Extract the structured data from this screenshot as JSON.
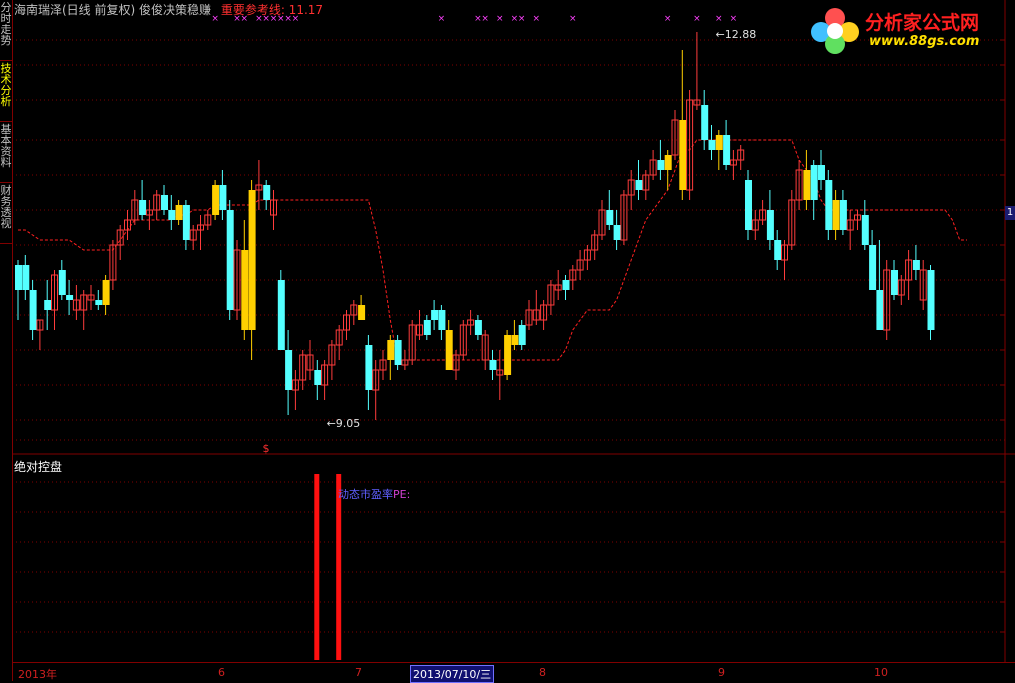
{
  "header": {
    "title": "海南瑞泽(日线 前复权) 俊俊决策稳赚",
    "ref_label": "重要参考线: 11.17"
  },
  "left_tabs": [
    {
      "label": "分时走势",
      "active": false
    },
    {
      "label": "技术分析",
      "active": true
    },
    {
      "label": "基本资料",
      "active": false
    },
    {
      "label": "财务透视",
      "active": false
    }
  ],
  "logo": {
    "brand": "分析家公式网",
    "url": "www.88gs.com"
  },
  "price_axis_tag": "1",
  "sub_panel": {
    "title": "绝对控盘",
    "label_text": "动态市盈率",
    "label_pe": "PE:"
  },
  "date_axis": {
    "labels": [
      "2013年",
      "6",
      "7",
      "8",
      "9",
      "10"
    ],
    "cursor": "2013/07/10/三"
  },
  "chart_data": {
    "type": "candlestick",
    "high_marker": "12.88",
    "low_marker": "9.05",
    "dollar_marker": "$",
    "colors": {
      "up": "#ff3c3c",
      "down": "#54ffff",
      "signal": "#ffd000",
      "ref_line": "#ff2020",
      "grid": "#800000",
      "sub_bar": "#ff1010"
    },
    "ylim": [
      8.8,
      13.0
    ],
    "candles": [
      [
        10.3,
        10.6,
        10.0,
        10.55,
        "d"
      ],
      [
        10.55,
        10.65,
        10.2,
        10.3,
        "d"
      ],
      [
        10.3,
        10.4,
        9.8,
        9.9,
        "d"
      ],
      [
        9.9,
        10.0,
        9.7,
        10.0,
        "u"
      ],
      [
        10.2,
        10.4,
        9.9,
        10.1,
        "d"
      ],
      [
        10.1,
        10.5,
        9.9,
        10.45,
        "u"
      ],
      [
        10.5,
        10.6,
        10.2,
        10.25,
        "d"
      ],
      [
        10.25,
        10.4,
        10.05,
        10.2,
        "d"
      ],
      [
        10.2,
        10.35,
        10.0,
        10.1,
        "u"
      ],
      [
        10.1,
        10.3,
        9.9,
        10.25,
        "u"
      ],
      [
        10.25,
        10.35,
        10.1,
        10.2,
        "u"
      ],
      [
        10.2,
        10.3,
        10.1,
        10.15,
        "d"
      ],
      [
        10.15,
        10.45,
        10.05,
        10.4,
        "s"
      ],
      [
        10.4,
        10.8,
        10.3,
        10.75,
        "u"
      ],
      [
        10.75,
        10.95,
        10.6,
        10.9,
        "u"
      ],
      [
        10.9,
        11.1,
        10.8,
        11.0,
        "u"
      ],
      [
        11.0,
        11.3,
        10.95,
        11.2,
        "u"
      ],
      [
        11.2,
        11.4,
        11.0,
        11.05,
        "d"
      ],
      [
        11.05,
        11.2,
        10.9,
        11.1,
        "u"
      ],
      [
        11.1,
        11.3,
        11.0,
        11.25,
        "u"
      ],
      [
        11.25,
        11.35,
        11.05,
        11.1,
        "d"
      ],
      [
        11.1,
        11.25,
        10.9,
        11.0,
        "d"
      ],
      [
        11.0,
        11.2,
        10.95,
        11.15,
        "s"
      ],
      [
        11.15,
        11.2,
        10.7,
        10.8,
        "d"
      ],
      [
        10.8,
        10.95,
        10.7,
        10.9,
        "u"
      ],
      [
        10.9,
        11.05,
        10.7,
        10.95,
        "u"
      ],
      [
        10.95,
        11.1,
        10.9,
        11.05,
        "u"
      ],
      [
        11.05,
        11.4,
        11.0,
        11.35,
        "s"
      ],
      [
        11.35,
        11.5,
        11.0,
        11.1,
        "d"
      ],
      [
        11.1,
        11.2,
        10.0,
        10.1,
        "d"
      ],
      [
        10.1,
        10.8,
        10.0,
        10.7,
        "u"
      ],
      [
        10.7,
        11.0,
        9.8,
        9.9,
        "s"
      ],
      [
        9.9,
        11.4,
        9.6,
        11.3,
        "s"
      ],
      [
        11.3,
        11.6,
        11.1,
        11.35,
        "u"
      ],
      [
        11.35,
        11.4,
        11.1,
        11.2,
        "d"
      ],
      [
        11.2,
        11.3,
        10.9,
        11.05,
        "u"
      ],
      [
        10.4,
        10.5,
        9.8,
        9.7,
        "d"
      ],
      [
        9.7,
        9.9,
        9.05,
        9.3,
        "d"
      ],
      [
        9.3,
        9.5,
        9.1,
        9.4,
        "u"
      ],
      [
        9.4,
        9.7,
        9.3,
        9.65,
        "u"
      ],
      [
        9.65,
        9.8,
        9.4,
        9.5,
        "u"
      ],
      [
        9.5,
        9.6,
        9.2,
        9.35,
        "d"
      ],
      [
        9.35,
        9.6,
        9.2,
        9.55,
        "u"
      ],
      [
        9.55,
        9.8,
        9.4,
        9.75,
        "u"
      ],
      [
        9.75,
        9.95,
        9.6,
        9.9,
        "u"
      ],
      [
        9.9,
        10.1,
        9.8,
        10.05,
        "u"
      ],
      [
        10.05,
        10.2,
        9.95,
        10.15,
        "u"
      ],
      [
        10.15,
        10.25,
        10.0,
        10.0,
        "s"
      ],
      [
        9.75,
        9.85,
        9.1,
        9.3,
        "d"
      ],
      [
        9.3,
        9.6,
        9.0,
        9.5,
        "u"
      ],
      [
        9.5,
        9.7,
        9.4,
        9.6,
        "u"
      ],
      [
        9.6,
        9.85,
        9.4,
        9.8,
        "s"
      ],
      [
        9.8,
        9.85,
        9.5,
        9.55,
        "d"
      ],
      [
        9.55,
        9.7,
        9.5,
        9.6,
        "u"
      ],
      [
        9.6,
        10.0,
        9.55,
        9.95,
        "u"
      ],
      [
        9.95,
        10.1,
        9.8,
        9.85,
        "u"
      ],
      [
        9.85,
        10.05,
        9.8,
        10.0,
        "d"
      ],
      [
        10.0,
        10.2,
        9.9,
        10.1,
        "d"
      ],
      [
        10.1,
        10.15,
        9.8,
        9.9,
        "d"
      ],
      [
        9.9,
        10.0,
        9.6,
        9.5,
        "s"
      ],
      [
        9.5,
        9.7,
        9.4,
        9.65,
        "u"
      ],
      [
        9.65,
        10.0,
        9.6,
        9.95,
        "u"
      ],
      [
        9.95,
        10.1,
        9.85,
        10.0,
        "u"
      ],
      [
        10.0,
        10.05,
        9.8,
        9.85,
        "d"
      ],
      [
        9.85,
        9.9,
        9.5,
        9.6,
        "u"
      ],
      [
        9.6,
        9.7,
        9.4,
        9.5,
        "d"
      ],
      [
        9.5,
        9.7,
        9.2,
        9.45,
        "u"
      ],
      [
        9.45,
        9.9,
        9.4,
        9.85,
        "s"
      ],
      [
        9.85,
        10.0,
        9.7,
        9.75,
        "s"
      ],
      [
        9.75,
        10.0,
        9.7,
        9.95,
        "d"
      ],
      [
        9.95,
        10.2,
        9.9,
        10.1,
        "u"
      ],
      [
        10.1,
        10.3,
        9.95,
        10.0,
        "u"
      ],
      [
        10.0,
        10.2,
        9.9,
        10.15,
        "u"
      ],
      [
        10.15,
        10.4,
        10.05,
        10.35,
        "u"
      ],
      [
        10.35,
        10.5,
        10.2,
        10.3,
        "u"
      ],
      [
        10.3,
        10.45,
        10.2,
        10.4,
        "d"
      ],
      [
        10.4,
        10.55,
        10.3,
        10.5,
        "u"
      ],
      [
        10.5,
        10.7,
        10.4,
        10.6,
        "u"
      ],
      [
        10.6,
        10.75,
        10.5,
        10.7,
        "u"
      ],
      [
        10.7,
        10.9,
        10.6,
        10.85,
        "u"
      ],
      [
        10.85,
        11.2,
        10.8,
        11.1,
        "u"
      ],
      [
        11.1,
        11.3,
        10.9,
        10.95,
        "d"
      ],
      [
        10.95,
        11.1,
        10.7,
        10.8,
        "d"
      ],
      [
        10.8,
        11.3,
        10.75,
        11.25,
        "u"
      ],
      [
        11.25,
        11.5,
        11.1,
        11.4,
        "u"
      ],
      [
        11.4,
        11.6,
        11.2,
        11.3,
        "d"
      ],
      [
        11.3,
        11.5,
        11.2,
        11.45,
        "u"
      ],
      [
        11.45,
        11.7,
        11.4,
        11.6,
        "u"
      ],
      [
        11.6,
        11.8,
        11.4,
        11.5,
        "d"
      ],
      [
        11.5,
        11.7,
        11.3,
        11.65,
        "s"
      ],
      [
        11.65,
        12.1,
        11.6,
        12.0,
        "u"
      ],
      [
        12.0,
        12.7,
        11.2,
        11.3,
        "s"
      ],
      [
        11.3,
        12.3,
        11.2,
        12.2,
        "u"
      ],
      [
        12.2,
        12.88,
        12.1,
        12.15,
        "u"
      ],
      [
        12.15,
        12.3,
        11.7,
        11.8,
        "d"
      ],
      [
        11.8,
        11.95,
        11.6,
        11.7,
        "d"
      ],
      [
        11.7,
        11.9,
        11.5,
        11.85,
        "s"
      ],
      [
        11.85,
        12.0,
        11.5,
        11.55,
        "d"
      ],
      [
        11.55,
        11.7,
        11.4,
        11.6,
        "u"
      ],
      [
        11.6,
        11.75,
        11.5,
        11.7,
        "u"
      ],
      [
        11.4,
        11.5,
        10.8,
        10.9,
        "d"
      ],
      [
        10.9,
        11.1,
        10.8,
        11.0,
        "u"
      ],
      [
        11.0,
        11.2,
        10.95,
        11.1,
        "u"
      ],
      [
        11.1,
        11.3,
        10.7,
        10.8,
        "d"
      ],
      [
        10.8,
        10.9,
        10.5,
        10.6,
        "d"
      ],
      [
        10.6,
        10.8,
        10.4,
        10.75,
        "u"
      ],
      [
        10.75,
        11.3,
        10.7,
        11.2,
        "u"
      ],
      [
        11.2,
        11.6,
        11.1,
        11.5,
        "u"
      ],
      [
        11.5,
        11.7,
        11.1,
        11.2,
        "s"
      ],
      [
        11.2,
        11.6,
        11.0,
        11.55,
        "d"
      ],
      [
        11.55,
        11.7,
        11.3,
        11.4,
        "d"
      ],
      [
        11.4,
        11.5,
        10.8,
        10.9,
        "d"
      ],
      [
        10.9,
        11.3,
        10.8,
        11.2,
        "s"
      ],
      [
        11.2,
        11.3,
        10.85,
        10.9,
        "d"
      ],
      [
        10.9,
        11.1,
        10.7,
        11.0,
        "u"
      ],
      [
        11.0,
        11.1,
        10.9,
        11.05,
        "u"
      ],
      [
        11.05,
        11.2,
        10.7,
        10.75,
        "d"
      ],
      [
        10.75,
        10.9,
        10.4,
        10.3,
        "d"
      ],
      [
        10.3,
        10.8,
        10.0,
        9.9,
        "d"
      ],
      [
        9.9,
        10.6,
        9.8,
        10.5,
        "u"
      ],
      [
        10.5,
        10.6,
        10.2,
        10.25,
        "d"
      ],
      [
        10.25,
        10.45,
        10.15,
        10.4,
        "u"
      ],
      [
        10.4,
        10.7,
        10.2,
        10.6,
        "u"
      ],
      [
        10.6,
        10.75,
        10.4,
        10.5,
        "d"
      ],
      [
        10.5,
        10.6,
        10.1,
        10.2,
        "u"
      ],
      [
        10.5,
        10.55,
        9.8,
        9.9,
        "d"
      ]
    ],
    "ref_line": [
      10.9,
      10.9,
      10.85,
      10.8,
      10.8,
      10.8,
      10.8,
      10.8,
      10.75,
      10.7,
      10.7,
      10.7,
      10.7,
      10.7,
      10.8,
      10.9,
      11.0,
      11.0,
      11.0,
      11.0,
      11.0,
      11.0,
      11.05,
      11.05,
      11.1,
      11.1,
      11.1,
      11.15,
      11.15,
      11.15,
      11.15,
      11.15,
      11.15,
      11.2,
      11.2,
      11.2,
      11.2,
      11.2,
      11.2,
      11.2,
      11.2,
      11.2,
      11.2,
      11.2,
      11.2,
      11.2,
      11.2,
      11.2,
      11.2,
      10.9,
      10.5,
      10.0,
      9.6,
      9.6,
      9.6,
      9.6,
      9.6,
      9.6,
      9.6,
      9.6,
      9.6,
      9.6,
      9.6,
      9.6,
      9.6,
      9.6,
      9.6,
      9.6,
      9.6,
      9.6,
      9.6,
      9.6,
      9.6,
      9.6,
      9.6,
      9.7,
      9.9,
      10.0,
      10.1,
      10.1,
      10.1,
      10.1,
      10.2,
      10.4,
      10.6,
      10.8,
      11.0,
      11.1,
      11.2,
      11.3,
      11.5,
      11.7,
      11.7,
      11.8,
      11.8,
      11.8,
      11.8,
      11.8,
      11.8,
      11.8,
      11.8,
      11.8,
      11.8,
      11.8,
      11.8,
      11.8,
      11.8,
      11.6,
      11.5,
      11.4,
      11.2,
      11.1,
      11.1,
      11.1,
      11.1,
      11.1,
      11.1,
      11.1,
      11.1,
      11.1,
      11.1,
      11.1,
      11.1,
      11.1,
      11.1,
      11.1,
      11.1,
      11.1,
      11.0,
      10.8,
      10.8
    ],
    "signal_marks": [
      27,
      30,
      31,
      33,
      34,
      35,
      36,
      37,
      38,
      58,
      63,
      64,
      66,
      68,
      69,
      71,
      76,
      89,
      93,
      96,
      98
    ],
    "sub_bars": [
      41,
      44
    ]
  }
}
